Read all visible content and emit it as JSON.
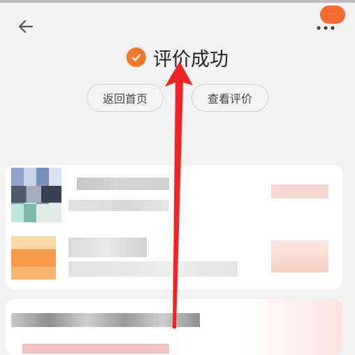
{
  "header": {
    "badge": "· · · ·",
    "title": "评价成功"
  },
  "actions": {
    "home_label": "返回首页",
    "view_label": "查看评价"
  },
  "colors": {
    "accent": "#f26a2e",
    "annotation_arrow": "#f22323"
  },
  "icons": {
    "back": "arrow-left-icon",
    "more": "more-dots-icon",
    "success": "check-circle-icon"
  }
}
